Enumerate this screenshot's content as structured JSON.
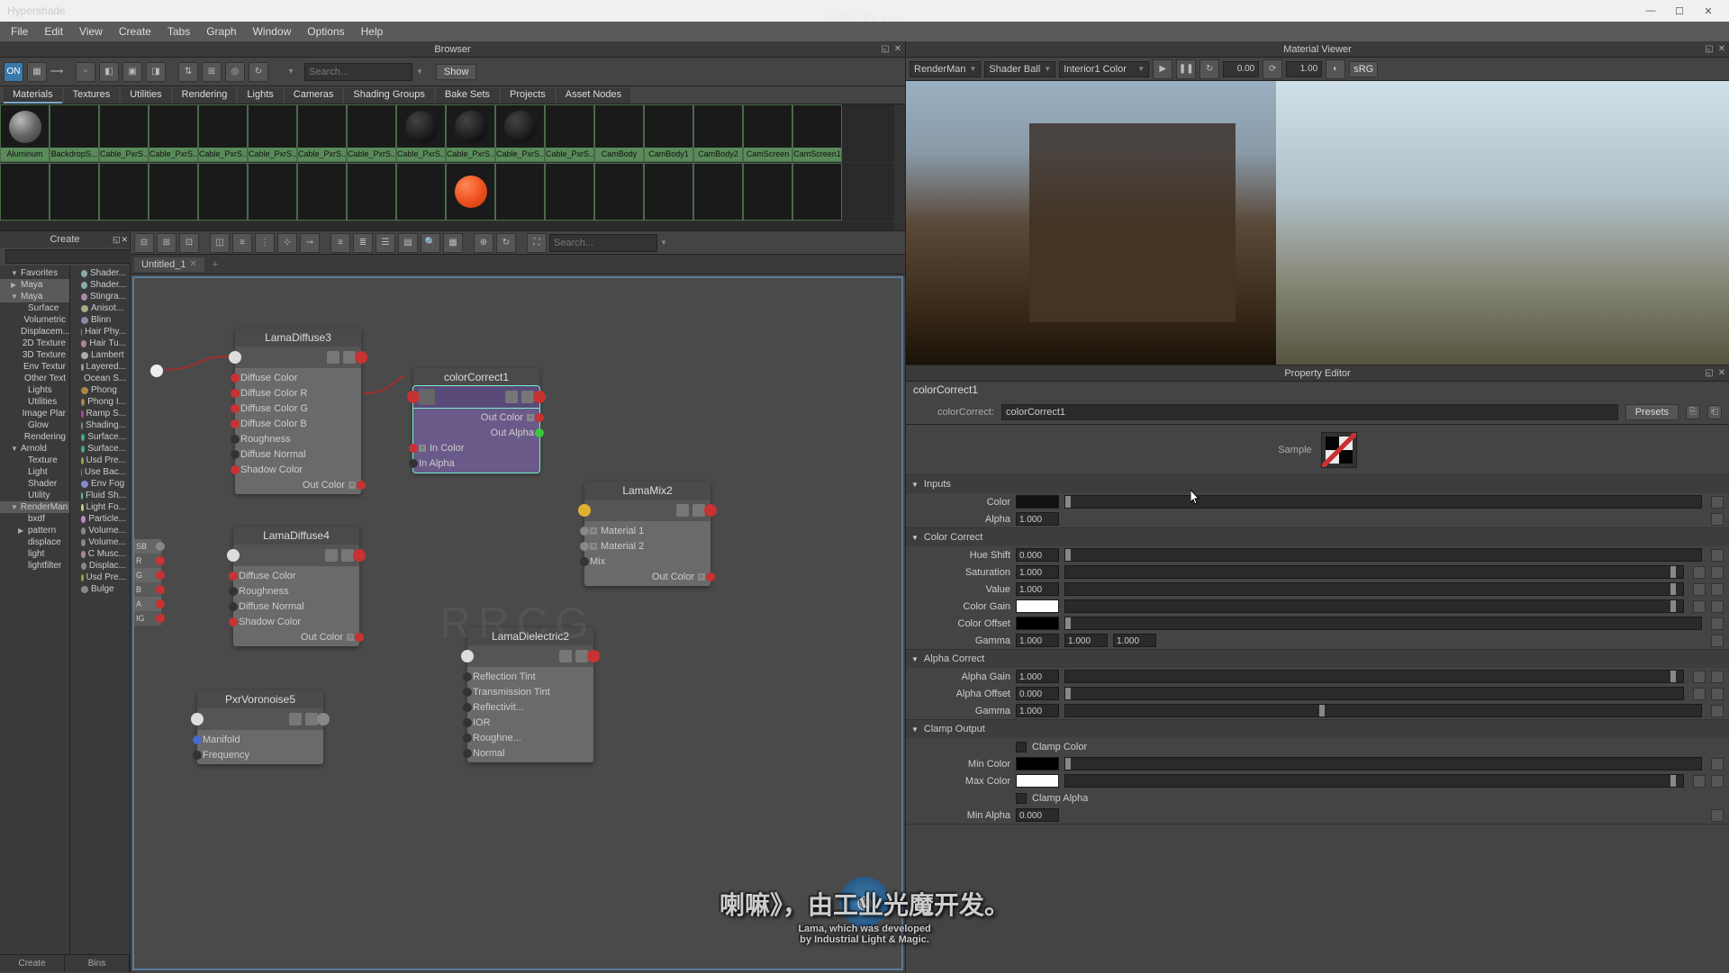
{
  "window": {
    "title": "Hypershade"
  },
  "menubar": [
    "File",
    "Edit",
    "View",
    "Create",
    "Tabs",
    "Graph",
    "Window",
    "Options",
    "Help"
  ],
  "browser": {
    "label": "Browser",
    "search_placeholder": "Search...",
    "show": "Show",
    "tabs": [
      "Materials",
      "Textures",
      "Utilities",
      "Rendering",
      "Lights",
      "Cameras",
      "Shading Groups",
      "Bake Sets",
      "Projects",
      "Asset Nodes"
    ],
    "swatches_row1": [
      "Aluminum",
      "BackdropS...",
      "Cable_PxrS...",
      "Cable_PxrS...",
      "Cable_PxrS...",
      "Cable_PxrS...",
      "Cable_PxrS...",
      "Cable_PxrS...",
      "Cable_PxrS...",
      "Cable_PxrS...",
      "Cable_PxrS...",
      "Cable_PxrS...",
      "CamBody",
      "CamBody1",
      "CamBody2",
      "CamScreen",
      "CamScreen1"
    ],
    "swatches_row2_count": 17,
    "orange_index": 9
  },
  "create": {
    "label": "Create",
    "bottom_tabs": [
      "Create",
      "Bins"
    ],
    "left_tree": [
      {
        "t": "Favorites",
        "tw": "▼"
      },
      {
        "t": "Maya",
        "tw": "▶",
        "hi": true
      },
      {
        "t": "Maya",
        "tw": "▼",
        "hi": true
      },
      {
        "t": "Surface",
        "indent": 1
      },
      {
        "t": "Volumetric",
        "indent": 1
      },
      {
        "t": "Displacem...",
        "indent": 1
      },
      {
        "t": "2D Texture",
        "indent": 1
      },
      {
        "t": "3D Texture",
        "indent": 1
      },
      {
        "t": "Env Textur",
        "indent": 1
      },
      {
        "t": "Other Text",
        "indent": 1
      },
      {
        "t": "Lights",
        "indent": 1
      },
      {
        "t": "Utilities",
        "indent": 1
      },
      {
        "t": "Image Plar",
        "indent": 1
      },
      {
        "t": "Glow",
        "indent": 1
      },
      {
        "t": "Rendering",
        "indent": 1
      },
      {
        "t": "Arnold",
        "tw": "▼"
      },
      {
        "t": "Texture",
        "indent": 1
      },
      {
        "t": "Light",
        "indent": 1
      },
      {
        "t": "Shader",
        "indent": 1
      },
      {
        "t": "Utility",
        "indent": 1
      },
      {
        "t": "RenderMan",
        "tw": "▼",
        "hi": true
      },
      {
        "t": "bxdf",
        "indent": 1
      },
      {
        "t": "pattern",
        "tw": "▶",
        "indent": 1
      },
      {
        "t": "displace",
        "indent": 1
      },
      {
        "t": "light",
        "indent": 1
      },
      {
        "t": "lightfilter",
        "indent": 1
      }
    ],
    "right_tree": [
      {
        "t": "Shader...",
        "c": "#8aa"
      },
      {
        "t": "Shader...",
        "c": "#8aa"
      },
      {
        "t": "Stingra...",
        "c": "#a8a"
      },
      {
        "t": "Anisot...",
        "c": "#aa8"
      },
      {
        "t": "Blinn",
        "c": "#88a"
      },
      {
        "t": "Hair Phy...",
        "c": "#a88"
      },
      {
        "t": "Hair Tu...",
        "c": "#a88"
      },
      {
        "t": "Lambert",
        "c": "#aaa"
      },
      {
        "t": "Layered...",
        "c": "#8a8"
      },
      {
        "t": "Ocean S...",
        "c": "#48a"
      },
      {
        "t": "Phong",
        "c": "#a84"
      },
      {
        "t": "Phong I...",
        "c": "#a84"
      },
      {
        "t": "Ramp S...",
        "c": "#a4a"
      },
      {
        "t": "Shading...",
        "c": "#888"
      },
      {
        "t": "Surface...",
        "c": "#4a8"
      },
      {
        "t": "Surface...",
        "c": "#4a8"
      },
      {
        "t": "Usd Pre...",
        "c": "#8a4"
      },
      {
        "t": "Use Bac...",
        "c": "#888"
      },
      {
        "t": "Env Fog",
        "c": "#88c"
      },
      {
        "t": "Fluid Sh...",
        "c": "#4cc"
      },
      {
        "t": "Light Fo...",
        "c": "#cc8"
      },
      {
        "t": "Particle...",
        "c": "#c8c"
      },
      {
        "t": "Volume...",
        "c": "#888"
      },
      {
        "t": "Volume...",
        "c": "#888"
      },
      {
        "t": "C Musc...",
        "c": "#a88"
      },
      {
        "t": "Displac...",
        "c": "#888"
      },
      {
        "t": "Usd Pre...",
        "c": "#8a4"
      },
      {
        "t": "Bulge",
        "c": "#888"
      }
    ]
  },
  "graph": {
    "search_placeholder": "Search...",
    "tab": "Untitled_1",
    "nodes": {
      "lamaDiffuse3": {
        "title": "LamaDiffuse3",
        "rows_in": [
          "Diffuse Color",
          "Diffuse Color R",
          "Diffuse Color G",
          "Diffuse Color B",
          "Roughness",
          "Diffuse Normal",
          "Shadow Color"
        ],
        "rows_out": [
          "Out Color"
        ]
      },
      "lamaDiffuse4": {
        "title": "LamaDiffuse4",
        "rows_in": [
          "Diffuse Color",
          "Roughness",
          "Diffuse Normal",
          "Shadow Color"
        ],
        "rows_out": [
          "Out Color"
        ]
      },
      "colorCorrect1": {
        "title": "colorCorrect1",
        "rows_out": [
          "Out Color",
          "Out Alpha"
        ],
        "rows_in": [
          "In Color",
          "In Alpha"
        ]
      },
      "lamaMix2": {
        "title": "LamaMix2",
        "rows_in": [
          "Material 1",
          "Material 2",
          "Mix"
        ],
        "rows_out": [
          "Out Color"
        ]
      },
      "lamaDielectric2": {
        "title": "LamaDielectric2",
        "rows_in": [
          "Reflection Tint",
          "Transmission Tint",
          "Reflectivit...",
          "IOR",
          "Roughne...",
          "Normal"
        ]
      },
      "pxrVoronoise5": {
        "title": "PxrVoronoise5",
        "rows_in": [
          "Manifold",
          "Frequency"
        ]
      },
      "tiny": {
        "rows": [
          "SB",
          "R",
          "G",
          "B",
          "A",
          "IG"
        ]
      }
    }
  },
  "viewer": {
    "label": "Material Viewer",
    "renderer": "RenderMan",
    "geom": "Shader Ball",
    "env": "Interior1 Color",
    "val1": "0.00",
    "val2": "1.00",
    "btn": "sRG"
  },
  "propeditor": {
    "label": "Property Editor",
    "node_name": "colorCorrect1",
    "type_label": "colorCorrect:",
    "field_value": "colorCorrect1",
    "presets": "Presets",
    "sample_label": "Sample",
    "sections": {
      "inputs": {
        "title": "Inputs",
        "color_lbl": "Color",
        "alpha_lbl": "Alpha",
        "alpha": "1.000"
      },
      "colorcorrect": {
        "title": "Color Correct",
        "hue_lbl": "Hue Shift",
        "hue": "0.000",
        "sat_lbl": "Saturation",
        "sat": "1.000",
        "val_lbl": "Value",
        "val": "1.000",
        "gain_lbl": "Color Gain",
        "offset_lbl": "Color Offset",
        "gamma_lbl": "Gamma",
        "g1": "1.000",
        "g2": "1.000",
        "g3": "1.000"
      },
      "alphacorrect": {
        "title": "Alpha Correct",
        "again_lbl": "Alpha Gain",
        "again": "1.000",
        "aoff_lbl": "Alpha Offset",
        "aoff": "0.000",
        "agam_lbl": "Gamma",
        "agam": "1.000"
      },
      "clamp": {
        "title": "Clamp Output",
        "clampc_lbl": "Clamp Color",
        "minc_lbl": "Min Color",
        "maxc_lbl": "Max Color",
        "clampa_lbl": "Clamp Alpha",
        "mina_lbl": "Min Alpha",
        "mina": "0.000"
      }
    }
  },
  "subtitle": {
    "cn": "喇嘛》，由工业光魔开发。",
    "en1": "Lama, which was developed",
    "en2": "by Industrial Light & Magic."
  },
  "watermark": "RRCG"
}
